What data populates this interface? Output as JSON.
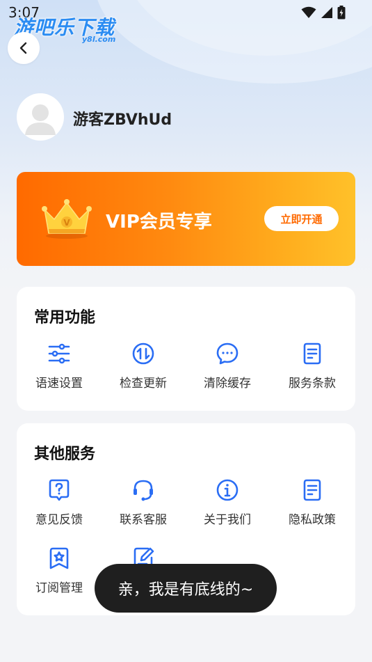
{
  "status_bar": {
    "time": "3:07"
  },
  "watermark": {
    "brand": "游吧乐下载",
    "domain": "y8l.com"
  },
  "header": {
    "back_icon": "chevron-left-icon"
  },
  "profile": {
    "username": "游客ZBVhUd",
    "avatar_icon": "user-silhouette-icon"
  },
  "vip": {
    "title": "VIP会员专享",
    "button_label": "立即开通",
    "crown_letter": "V",
    "colors": {
      "gradient_start": "#ff6a00",
      "gradient_end": "#ffc12a"
    }
  },
  "common_functions": {
    "title": "常用功能",
    "items": [
      {
        "label": "语速设置",
        "icon": "sliders-icon"
      },
      {
        "label": "检查更新",
        "icon": "update-arrows-icon"
      },
      {
        "label": "清除缓存",
        "icon": "chat-bubble-icon"
      },
      {
        "label": "服务条款",
        "icon": "document-icon"
      }
    ]
  },
  "other_services": {
    "title": "其他服务",
    "items": [
      {
        "label": "意见反馈",
        "icon": "question-bubble-icon"
      },
      {
        "label": "联系客服",
        "icon": "headset-icon"
      },
      {
        "label": "关于我们",
        "icon": "info-icon"
      },
      {
        "label": "隐私政策",
        "icon": "document-icon"
      },
      {
        "label": "订阅管理",
        "icon": "star-bookmark-icon"
      },
      {
        "label": "",
        "icon": "edit-note-icon"
      }
    ]
  },
  "toast": {
    "message": "亲，我是有底线的~"
  },
  "colors": {
    "accent_blue": "#2a6df4",
    "page_bg": "#f3f4f7"
  }
}
